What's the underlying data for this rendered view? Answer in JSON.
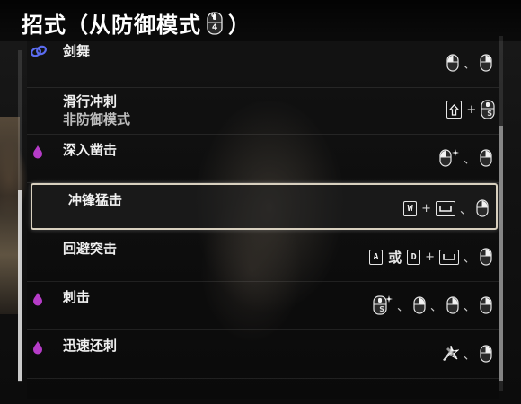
{
  "header": {
    "title_prefix": "招式（从防御模式",
    "title_suffix": "）",
    "title_icon": "mouse-scroll-icon"
  },
  "moves": [
    {
      "name": "剑舞",
      "subtitle": "",
      "icon": "chain-link-icon",
      "icon_color": "#5b6cf0",
      "inputs": [
        "mouse-left",
        "sep",
        "mouse-right"
      ]
    },
    {
      "name": "滑行冲刺",
      "subtitle": "非防御模式",
      "icon": "",
      "inputs": [
        "arrow-key",
        "plus",
        "mouse-scroll-s"
      ]
    },
    {
      "name": "深入凿击",
      "subtitle": "",
      "icon": "purple-drop-icon",
      "icon_color": "#b63cc8",
      "inputs": [
        "mouse-left-spark",
        "sep",
        "mouse-right"
      ]
    },
    {
      "name": "冲锋猛击",
      "subtitle": "",
      "icon": "",
      "selected": true,
      "inputs": [
        "key-W",
        "plus",
        "key-space",
        "sep",
        "mouse-right"
      ]
    },
    {
      "name": "回避突击",
      "subtitle": "",
      "icon": "",
      "inputs": [
        "key-A",
        "or",
        "key-D",
        "plus",
        "key-space",
        "sep",
        "mouse-right"
      ]
    },
    {
      "name": "刺击",
      "subtitle": "",
      "icon": "purple-drop-icon",
      "icon_color": "#b63cc8",
      "inputs": [
        "mouse-scroll-s-spark",
        "sep",
        "mouse-right",
        "sep",
        "mouse-right",
        "sep",
        "mouse-right"
      ]
    },
    {
      "name": "迅速还刺",
      "subtitle": "",
      "icon": "purple-drop-icon",
      "icon_color": "#b63cc8",
      "inputs": [
        "parry-icon",
        "sep",
        "mouse-right"
      ]
    }
  ],
  "labels": {
    "or": "或",
    "plus": "+",
    "sep": "、",
    "key_W": "W",
    "key_A": "A",
    "key_D": "D",
    "scroll_digits_top": "0",
    "scroll_digits_bottom": "4",
    "scroll_s": "S"
  },
  "colors": {
    "selected_border": "#d8d0bf",
    "purple": "#b63cc8",
    "blue": "#5b6cf0"
  }
}
